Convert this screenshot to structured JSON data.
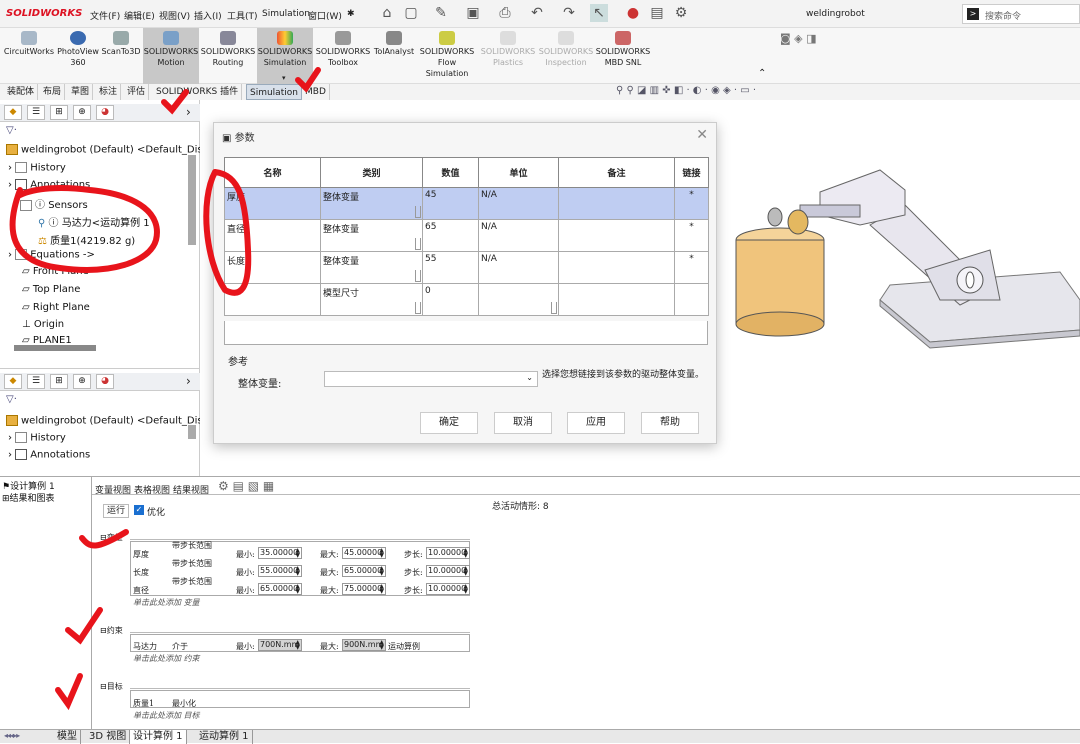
{
  "titlebar": {
    "logo": "SOLIDWORKS",
    "menus": [
      "文件(F)",
      "编辑(E)",
      "视图(V)",
      "插入(I)",
      "工具(T)",
      "Simulation",
      "窗口(W)"
    ],
    "doc_title": "weldingrobot",
    "search_placeholder": "搜索命令"
  },
  "ribbon": {
    "buttons": [
      {
        "label": "CircuitWorks",
        "sub": ""
      },
      {
        "label": "PhotoView",
        "sub": "360"
      },
      {
        "label": "ScanTo3D",
        "sub": ""
      },
      {
        "label": "SOLIDWORKS",
        "sub": "Motion"
      },
      {
        "label": "SOLIDWORKS",
        "sub": "Routing"
      },
      {
        "label": "SOLIDWORKS",
        "sub": "Simulation"
      },
      {
        "label": "SOLIDWORKS",
        "sub": "Toolbox"
      },
      {
        "label": "TolAnalyst",
        "sub": ""
      },
      {
        "label": "SOLIDWORKS",
        "sub": "Flow Simulation"
      },
      {
        "label": "SOLIDWORKS",
        "sub": "Plastics"
      },
      {
        "label": "SOLIDWORKS",
        "sub": "Inspection"
      },
      {
        "label": "SOLIDWORKS",
        "sub": "MBD SNL"
      }
    ]
  },
  "tabs": [
    "装配体",
    "布局",
    "草图",
    "标注",
    "评估",
    "SOLIDWORKS 插件",
    "Simulation",
    "MBD"
  ],
  "tree_top": {
    "root": "weldingrobot (Default) <Default_Dis",
    "items": [
      "History",
      "Annotations",
      "Sensors",
      "马达力<运动算例 1",
      "质量1(4219.82 g)",
      "Equations ->",
      "Front Plane",
      "Top Plane",
      "Right Plane",
      "Origin",
      "PLANE1"
    ]
  },
  "tree_bottom": {
    "root": "weldingrobot (Default) <Default_Dis",
    "items": [
      "History",
      "Annotations"
    ]
  },
  "dialog": {
    "title": "参数",
    "headers": [
      "名称",
      "类别",
      "数值",
      "单位",
      "备注",
      "链接"
    ],
    "rows": [
      {
        "name": "厚度",
        "category": "整体变量",
        "value": "45",
        "unit": "N/A",
        "note": "",
        "link": "*"
      },
      {
        "name": "直径",
        "category": "整体变量",
        "value": "65",
        "unit": "N/A",
        "note": "",
        "link": "*"
      },
      {
        "name": "长度",
        "category": "整体变量",
        "value": "55",
        "unit": "N/A",
        "note": "",
        "link": "*"
      },
      {
        "name": "",
        "category": "模型尺寸",
        "value": "0",
        "unit": "",
        "note": "",
        "link": ""
      }
    ],
    "ref_title": "参考",
    "ref_label": "整体变量:",
    "ref_hint": "选择您想链接到该参数的驱动整体变量。",
    "buttons": [
      "确定",
      "取消",
      "应用",
      "帮助"
    ]
  },
  "study": {
    "tree": [
      "设计算例 1",
      "结果和图表"
    ],
    "view_tabs": [
      "变量视图",
      "表格视图",
      "结果视图"
    ],
    "run": "运行",
    "optimize": "优化",
    "total_label": "总活动情形: 8",
    "sec_vars": "变量",
    "vars": [
      {
        "name": "厚度",
        "type": "带步长范围",
        "min": "35.00000",
        "max": "45.00000",
        "step": "10.00000"
      },
      {
        "name": "长度",
        "type": "带步长范围",
        "min": "55.00000",
        "max": "65.00000",
        "step": "10.00000"
      },
      {
        "name": "直径",
        "type": "带步长范围",
        "min": "65.00000",
        "max": "75.00000",
        "step": "10.00000"
      }
    ],
    "add_var": "单击此处添加 变量",
    "sec_cons": "约束",
    "cons": {
      "name": "马达力",
      "type": "介于",
      "min": "700N.mm",
      "max": "900N.mm",
      "study": "运动算例"
    },
    "add_cons": "单击此处添加 约束",
    "sec_goal": "目标",
    "goal": {
      "name": "质量1",
      "type": "最小化"
    },
    "add_goal": "单击此处添加 目标",
    "lbl_min": "最小:",
    "lbl_max": "最大:",
    "lbl_step": "步长:"
  },
  "bottom_tabs": [
    "模型",
    "3D 视图",
    "设计算例 1",
    "运动算例 1"
  ]
}
